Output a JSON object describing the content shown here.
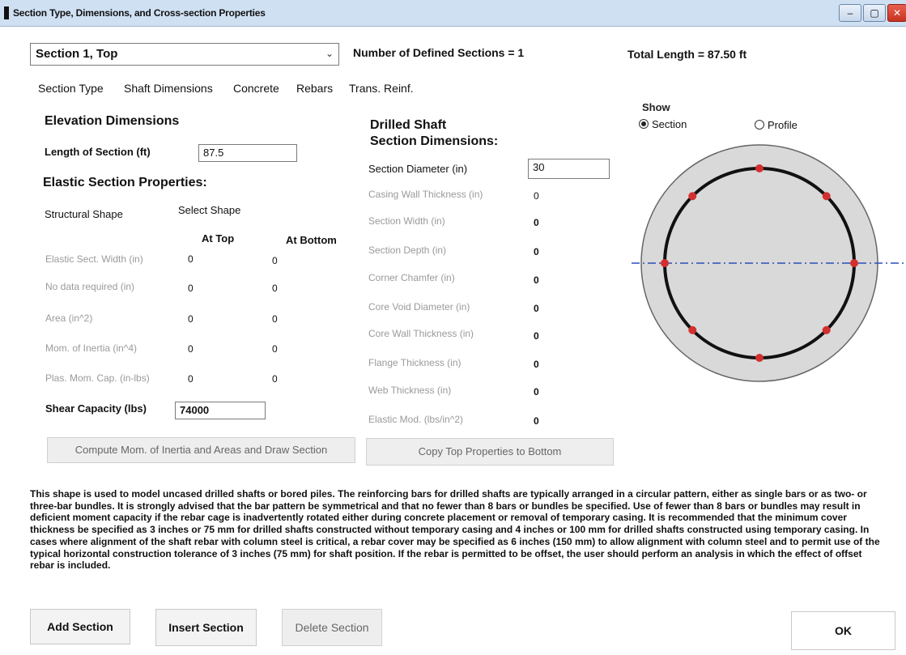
{
  "window": {
    "title": "Section Type, Dimensions, and Cross-section Properties"
  },
  "header": {
    "section_selected": "Section 1, Top",
    "num_sections": "Number of Defined Sections = 1",
    "total_length": "Total Length = 87.50 ft"
  },
  "tabs": [
    "Section Type",
    "Shaft Dimensions",
    "Concrete",
    "Rebars",
    "Trans. Reinf."
  ],
  "elevation": {
    "heading": "Elevation Dimensions",
    "length_label": "Length of Section (ft)",
    "length_value": "87.5"
  },
  "elastic": {
    "heading": "Elastic Section Properties:",
    "structural_shape_label": "Structural Shape",
    "select_shape_label": "Select Shape",
    "at_top": "At Top",
    "at_bottom": "At Bottom",
    "rows": [
      {
        "label": "Elastic Sect. Width (in)",
        "top": "0",
        "bottom": "0"
      },
      {
        "label": "No data required (in)",
        "top": "0",
        "bottom": "0"
      },
      {
        "label": "Area (in^2)",
        "top": "0",
        "bottom": "0"
      },
      {
        "label": "Mom. of Inertia (in^4)",
        "top": "0",
        "bottom": "0"
      },
      {
        "label": "Plas. Mom. Cap. (in-lbs)",
        "top": "0",
        "bottom": "0"
      }
    ],
    "shear_label": "Shear Capacity (lbs)",
    "shear_value": "74000"
  },
  "drilled": {
    "heading_line1": "Drilled Shaft",
    "heading_line2": "Section Dimensions:",
    "diameter_label": "Section Diameter (in)",
    "diameter_value": "30",
    "rows": [
      {
        "label": "Casing Wall Thickness (in)",
        "value": "0"
      },
      {
        "label": "Section Width (in)",
        "value": "0"
      },
      {
        "label": "Section Depth (in)",
        "value": "0"
      },
      {
        "label": "Corner Chamfer (in)",
        "value": "0"
      },
      {
        "label": "Core Void Diameter (in)",
        "value": "0"
      },
      {
        "label": "Core Wall Thickness (in)",
        "value": "0"
      },
      {
        "label": "Flange Thickness (in)",
        "value": "0"
      },
      {
        "label": "Web Thickness (in)",
        "value": "0"
      },
      {
        "label": "Elastic Mod. (lbs/in^2)",
        "value": "0"
      }
    ]
  },
  "view": {
    "show_label": "Show",
    "section_label": "Section",
    "profile_label": "Profile",
    "selected": "Section"
  },
  "buttons": {
    "compute": "Compute Mom. of Inertia and Areas and Draw Section",
    "copy": "Copy Top Properties to Bottom",
    "add": "Add Section",
    "insert": "Insert Section",
    "delete": "Delete Section",
    "ok": "OK"
  },
  "description": "This shape is used to model uncased drilled shafts or bored piles. The reinforcing bars for drilled shafts are typically arranged in a circular pattern, either as single bars or as two- or three-bar bundles. It is strongly advised that the bar pattern be symmetrical and that no fewer than 8 bars or bundles be specified. Use of fewer than 8 bars or bundles may result in deficient moment capacity if the rebar cage is inadvertently rotated either during concrete placement or removal of temporary casing. It is recommended that the minimum cover thickness be specified as 3 inches or 75 mm for drilled shafts constructed without temporary casing and 4 inches or 100 mm for drilled shafts constructed using temporary casing. In cases where alignment of the shaft rebar with column steel is critical, a rebar cover may be specified as 6 inches (150 mm) to allow alignment with column steel and to permit use of the typical horizontal construction tolerance of 3 inches (75 mm) for shaft position. If the rebar is permitted to be offset, the user should perform an analysis in which the effect of offset rebar is included.",
  "colors": {
    "titlebar": "#cfe0f3",
    "rebar": "#d32f2f",
    "axis": "#2a4dbb",
    "concrete": "#d9d9d9"
  }
}
